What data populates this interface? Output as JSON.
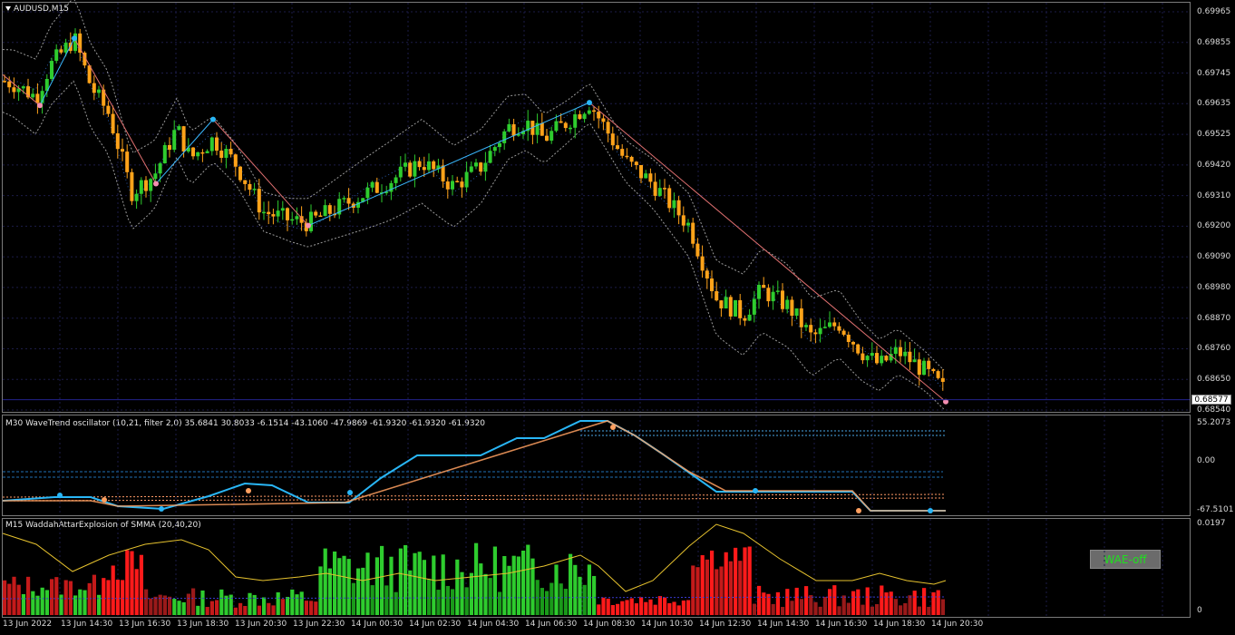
{
  "main": {
    "title": "AUDUSD,M15",
    "price_labels": [
      "0.69965",
      "0.69855",
      "0.69745",
      "0.69635",
      "0.69525",
      "0.69420",
      "0.69310",
      "0.69200",
      "0.69090",
      "0.68980",
      "0.68870",
      "0.68760",
      "0.68650",
      "0.68540"
    ],
    "current_price": "0.68577",
    "price_range": [
      0.6854,
      0.69965
    ],
    "colors": {
      "bull": "#2ecc2e",
      "bear": "#ffa31a",
      "channel": "#9a9a9a",
      "zigzag_up": "#3ab8ff",
      "zigzag_down": "#e07070",
      "grid": "#1c1c48"
    }
  },
  "wavetrend": {
    "title": "M30 WaveTrend oscillator (10,21, filter 2,0) 35.6841 30.8033 -6.1514 -43.1060 -47.9869 -61.9320 -61.9320 -61.9320",
    "scale": [
      "55.2073",
      "0.00",
      "-67.5101"
    ]
  },
  "wae": {
    "title": "M15 WaddahAttarExplosion of SMMA (20,40,20)",
    "scale": [
      "0.0197",
      "0"
    ],
    "button_label": "WAE-off"
  },
  "time_labels": [
    "13 Jun 2022",
    "13 Jun 14:30",
    "13 Jun 16:30",
    "13 Jun 18:30",
    "13 Jun 20:30",
    "13 Jun 22:30",
    "14 Jun 00:30",
    "14 Jun 02:30",
    "14 Jun 04:30",
    "14 Jun 06:30",
    "14 Jun 08:30",
    "14 Jun 10:30",
    "14 Jun 12:30",
    "14 Jun 14:30",
    "14 Jun 16:30",
    "14 Jun 18:30",
    "14 Jun 20:30"
  ]
}
